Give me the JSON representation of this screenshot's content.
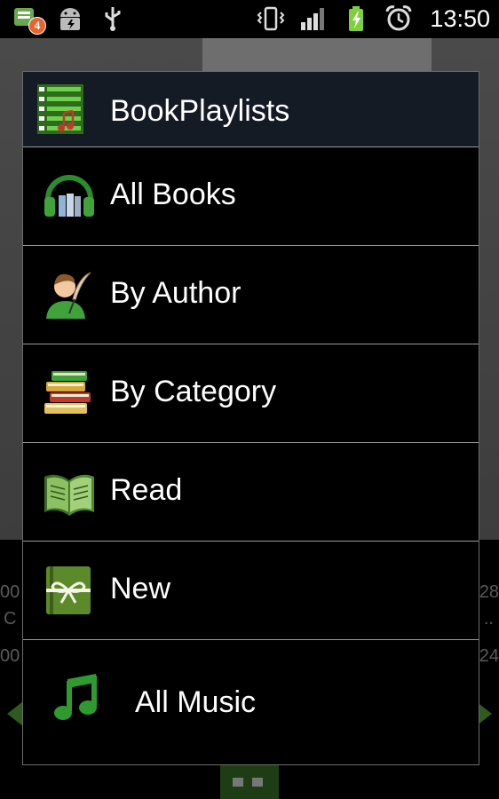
{
  "status_bar": {
    "notification_count": "4",
    "clock": "13:50"
  },
  "dialog": {
    "title": "BookPlaylists",
    "items": [
      {
        "label": "All Books",
        "icon": "headphones-book-icon"
      },
      {
        "label": "By Author",
        "icon": "author-quill-icon"
      },
      {
        "label": "By Category",
        "icon": "book-stack-icon"
      },
      {
        "label": "Read",
        "icon": "open-book-icon"
      },
      {
        "label": "New",
        "icon": "gift-book-icon"
      },
      {
        "label": "All Music",
        "icon": "music-note-icon"
      }
    ]
  },
  "colors": {
    "accent_green": "#3fa33a",
    "header_bg": "#141b24",
    "dialog_bg": "#000000"
  }
}
